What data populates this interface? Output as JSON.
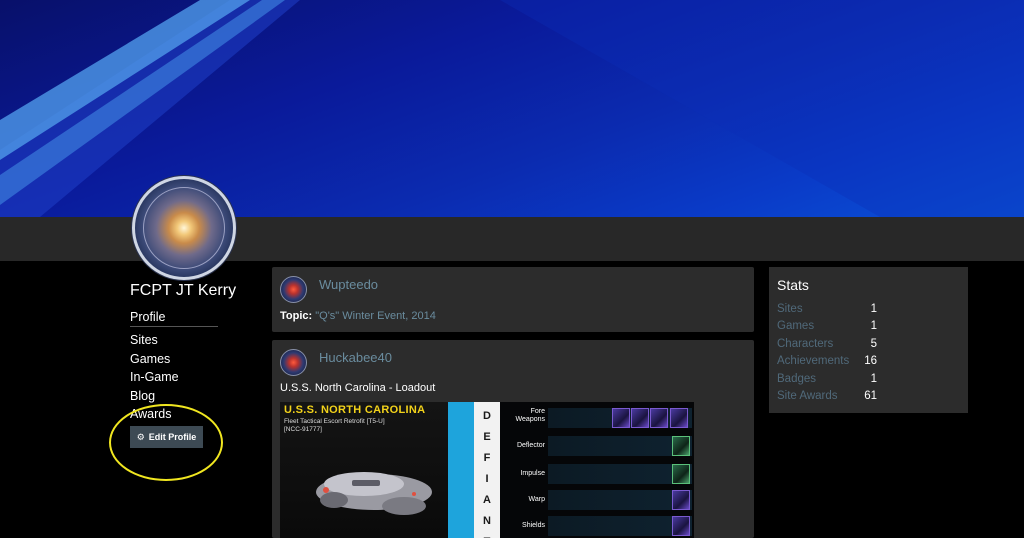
{
  "profile": {
    "user_name": "FCPT JT Kerry",
    "nav": [
      {
        "label": "Profile"
      },
      {
        "label": "Sites"
      },
      {
        "label": "Games"
      },
      {
        "label": "In-Game"
      },
      {
        "label": "Blog"
      },
      {
        "label": "Awards"
      }
    ],
    "edit_button_label": "Edit Profile",
    "edit_button_icon": "gear-icon"
  },
  "posts": [
    {
      "author": "Wupteedo",
      "topic_prefix": "Topic:",
      "topic_link": "\"Q's\" Winter Event, 2014"
    },
    {
      "author": "Huckabee40",
      "text": "U.S.S. North Carolina - Loadout"
    }
  ],
  "loadout": {
    "ship_name": "U.S.S. NORTH CAROLINA",
    "ship_class": "Fleet Tactical Escort Retrofit [T5-U]",
    "registry": "[NCC-91777]",
    "faction_letters": [
      "D",
      "E",
      "F",
      "I",
      "A",
      "N",
      "T"
    ],
    "slots": [
      {
        "label": "Fore\nWeapons"
      },
      {
        "label": "Deflector"
      },
      {
        "label": "Impulse"
      },
      {
        "label": "Warp"
      },
      {
        "label": "Shields"
      }
    ]
  },
  "stats": {
    "title": "Stats",
    "rows": [
      {
        "label": "Sites",
        "value": "1"
      },
      {
        "label": "Games",
        "value": "1"
      },
      {
        "label": "Characters",
        "value": "5"
      },
      {
        "label": "Achievements",
        "value": "16"
      },
      {
        "label": "Badges",
        "value": "1"
      },
      {
        "label": "Site Awards",
        "value": "61"
      }
    ]
  },
  "colors": {
    "link": "#6a8c9e",
    "stat_label": "#50697a",
    "highlight": "#f0e620",
    "faction_blue": "#1ea4dc",
    "ship_title": "#f2d21a"
  }
}
